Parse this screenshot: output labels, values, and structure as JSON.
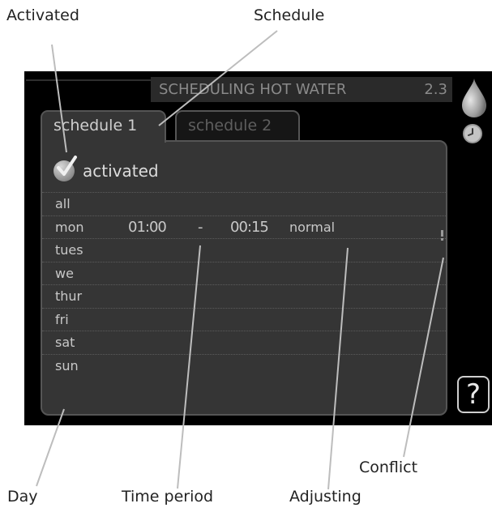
{
  "callouts": {
    "activated": "Activated",
    "schedule": "Schedule",
    "conflict": "Conflict",
    "day": "Day",
    "time_period": "Time period",
    "adjusting": "Adjusting"
  },
  "screen": {
    "title": "SCHEDULING HOT WATER",
    "menu_number": "2.3",
    "tabs": [
      {
        "label": "schedule 1",
        "active": true
      },
      {
        "label": "schedule 2",
        "active": false
      }
    ],
    "activated_label": "activated",
    "activated_checked": true,
    "rows": [
      {
        "day": "all",
        "start": "",
        "dash": "",
        "end": "",
        "setting": ""
      },
      {
        "day": "mon",
        "start": "01:00",
        "dash": "-",
        "end": "00:15",
        "setting": "normal"
      },
      {
        "day": "tues",
        "start": "",
        "dash": "",
        "end": "",
        "setting": ""
      },
      {
        "day": "we",
        "start": "",
        "dash": "",
        "end": "",
        "setting": ""
      },
      {
        "day": "thur",
        "start": "",
        "dash": "",
        "end": "",
        "setting": ""
      },
      {
        "day": "fri",
        "start": "",
        "dash": "",
        "end": "",
        "setting": ""
      },
      {
        "day": "sat",
        "start": "",
        "dash": "",
        "end": "",
        "setting": ""
      },
      {
        "day": "sun",
        "start": "",
        "dash": "",
        "end": "",
        "setting": ""
      }
    ],
    "icons": [
      "water-drop-icon",
      "clock-icon",
      "help-icon"
    ],
    "help_label": "?"
  },
  "colors": {
    "screen_background": "#000000",
    "panel_background": "#353535",
    "text": "#c8c8c8",
    "leader_line": "#bdbdbd"
  }
}
